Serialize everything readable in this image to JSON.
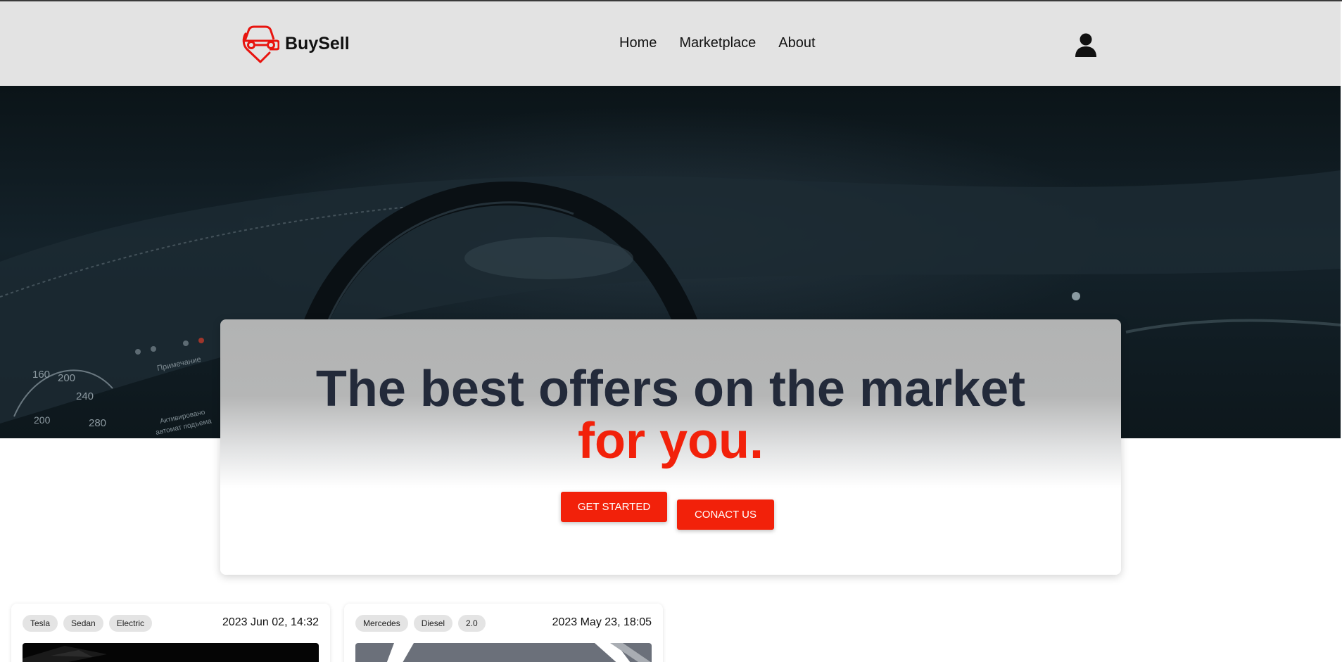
{
  "brand": {
    "name": "BuySell",
    "logo_icon": "car-heart-icon",
    "accent_color": "#f2210a"
  },
  "nav": {
    "items": [
      {
        "label": "Home"
      },
      {
        "label": "Marketplace"
      },
      {
        "label": "About"
      }
    ],
    "user_icon": "user-icon"
  },
  "hero": {
    "headline_main": "The best offers on the market",
    "headline_accent": "for you.",
    "primary_button": "GET STARTED",
    "secondary_button": "CONACT US",
    "gauge_labels": [
      "160",
      "200",
      "240",
      "200",
      "280"
    ],
    "dash_text": [
      "Примечание",
      "Активировано",
      "автомат подъема"
    ]
  },
  "listings": [
    {
      "tags": [
        "Tesla",
        "Sedan",
        "Electric"
      ],
      "date": "2023 Jun 02, 14:32"
    },
    {
      "tags": [
        "Mercedes",
        "Diesel",
        "2.0"
      ],
      "date": "2023 May 23, 18:05"
    }
  ]
}
